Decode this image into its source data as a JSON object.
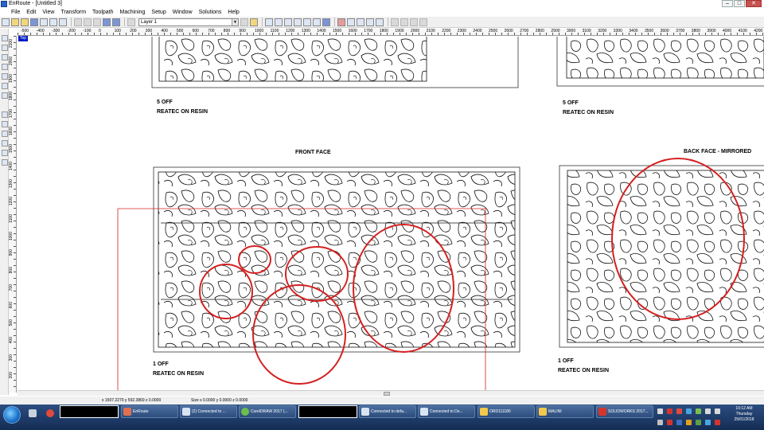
{
  "window": {
    "title": "EnRoute - [Untitled 3]"
  },
  "menu": [
    "File",
    "Edit",
    "View",
    "Transform",
    "Toolpath",
    "Machining",
    "Setup",
    "Window",
    "Solutions",
    "Help"
  ],
  "toolbar": {
    "layer": "Layer 1"
  },
  "view_badge": "Top",
  "ruler": {
    "h_labels": [
      "-500",
      "-400",
      "-300",
      "-200",
      "-100",
      "0",
      "100",
      "200",
      "300",
      "400",
      "500",
      "600",
      "700",
      "800",
      "900",
      "1000",
      "1100",
      "1200",
      "1300",
      "1400",
      "1500",
      "1600",
      "1700",
      "1800",
      "1900",
      "2000",
      "2100",
      "2200",
      "2300",
      "2400",
      "2500",
      "2600",
      "2700",
      "2800",
      "2900",
      "3000",
      "3100",
      "3200",
      "3300",
      "3400",
      "3500",
      "3600",
      "3700",
      "3800",
      "3900",
      "4000",
      "4100",
      "4200"
    ],
    "v_labels": [
      "2100",
      "2000",
      "1900",
      "1800",
      "1700",
      "1600",
      "1500",
      "1400",
      "1300",
      "1200",
      "1100",
      "1000",
      "900",
      "800",
      "700",
      "600",
      "500",
      "400",
      "300",
      "200"
    ]
  },
  "canvas": {
    "top_left_qty": "5 OFF",
    "top_left_material": "REATEC ON RESIN",
    "top_right_qty": "5 OFF",
    "top_right_material": "REATEC ON RESIN",
    "front_title": "FRONT FACE",
    "back_title": "BACK FACE - MIRRORED",
    "front_qty": "1 OFF",
    "front_material": "REATEC ON RESIN",
    "back_qty": "1 OFF",
    "back_material": "REATEC ON RESIN"
  },
  "status": {
    "coords": "x 1507.2270 y 592.3869 z 0.0000",
    "size": "Size x 0.0000 y 0.0000 z 0.0000"
  },
  "taskbar": {
    "buttons": [
      {
        "label": "EnRoute",
        "icon": "enroute-icon"
      },
      {
        "label": "(2) Connected to ...",
        "icon": "remote-desktop-icon"
      },
      {
        "label": "CorelDRAW 2017 (...",
        "icon": "coreldraw-icon"
      },
      {
        "label": "Connected to defa...",
        "icon": "remote-desktop-icon"
      },
      {
        "label": "Connected to De...",
        "icon": "remote-desktop-icon"
      },
      {
        "label": "ORD111180",
        "icon": "folder-icon"
      },
      {
        "label": "MALINI",
        "icon": "folder-icon"
      },
      {
        "label": "SOLIDWORKS 2017...",
        "icon": "solidworks-icon"
      }
    ],
    "clock": {
      "time": "10:12 AM",
      "day": "Thursday",
      "date": "25/01/2018"
    }
  },
  "colors": {
    "markup": "#d42020",
    "taskbar": "#1c3a66",
    "view_badge": "#0019c8"
  }
}
